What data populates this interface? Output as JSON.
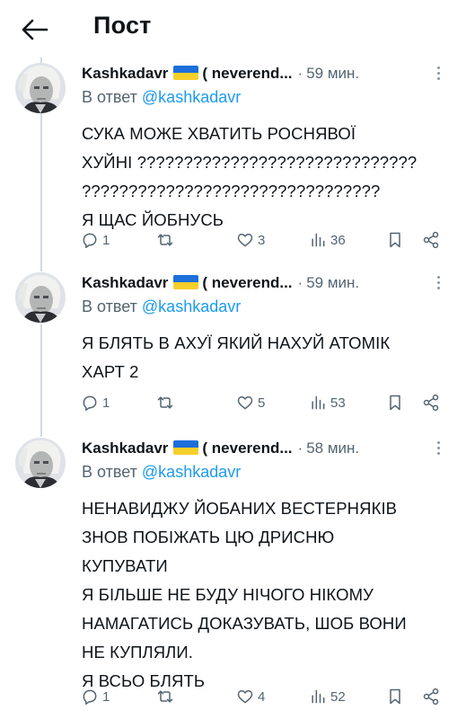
{
  "header": {
    "title": "Пост"
  },
  "tweets": [
    {
      "author": "Kashkadavr",
      "handle_trunc": "( neverend...",
      "separator": "·",
      "time": "59 мин.",
      "reply_prefix": "В ответ",
      "reply_handle": "@kashkadavr",
      "lines": [
        "СУКА МОЖЕ ХВАТИТЬ РОСНЯВОЇ",
        "ХУЙНІ ??????????????????????????????",
        "????????????????????????????????",
        "Я ЩАС ЙОБНУСЬ"
      ],
      "replies": "1",
      "retweets": "",
      "likes": "3",
      "views": "36"
    },
    {
      "author": "Kashkadavr",
      "handle_trunc": "( neverend...",
      "separator": "·",
      "time": "59 мин.",
      "reply_prefix": "В ответ",
      "reply_handle": "@kashkadavr",
      "lines": [
        "Я БЛЯТЬ В АХУЇ ЯКИЙ НАХУЙ АТОМІК",
        "ХАРТ 2"
      ],
      "replies": "1",
      "retweets": "",
      "likes": "5",
      "views": "53"
    },
    {
      "author": "Kashkadavr",
      "handle_trunc": "( neverend...",
      "separator": "·",
      "time": "58 мин.",
      "reply_prefix": "В ответ",
      "reply_handle": "@kashkadavr",
      "lines": [
        "НЕНАВИДЖУ ЙОБАНИХ ВЕСТЕРНЯКІВ",
        "ЗНОВ ПОБІЖАТЬ ЦЮ ДРИСНЮ",
        "КУПУВАТИ",
        "Я БІЛЬШЕ НЕ БУДУ НІЧОГО НІКОМУ",
        "НАМАГАТИСЬ ДОКАЗУВАТЬ, ШОБ ВОНИ",
        "НЕ КУПЛЯЛИ.",
        "Я ВСЬО БЛЯТЬ"
      ],
      "replies": "1",
      "retweets": "",
      "likes": "4",
      "views": "52"
    }
  ],
  "colors": {
    "text": "#0f1419",
    "secondary": "#536471",
    "link": "#1d9bf0",
    "thread_line": "#cfd9de",
    "flag_blue": "#1d6fd9",
    "flag_yellow": "#f7cf2a"
  },
  "icons": [
    "back-arrow-icon",
    "more-icon",
    "reply-icon",
    "retweet-icon",
    "like-icon",
    "views-icon",
    "bookmark-icon",
    "share-icon"
  ]
}
